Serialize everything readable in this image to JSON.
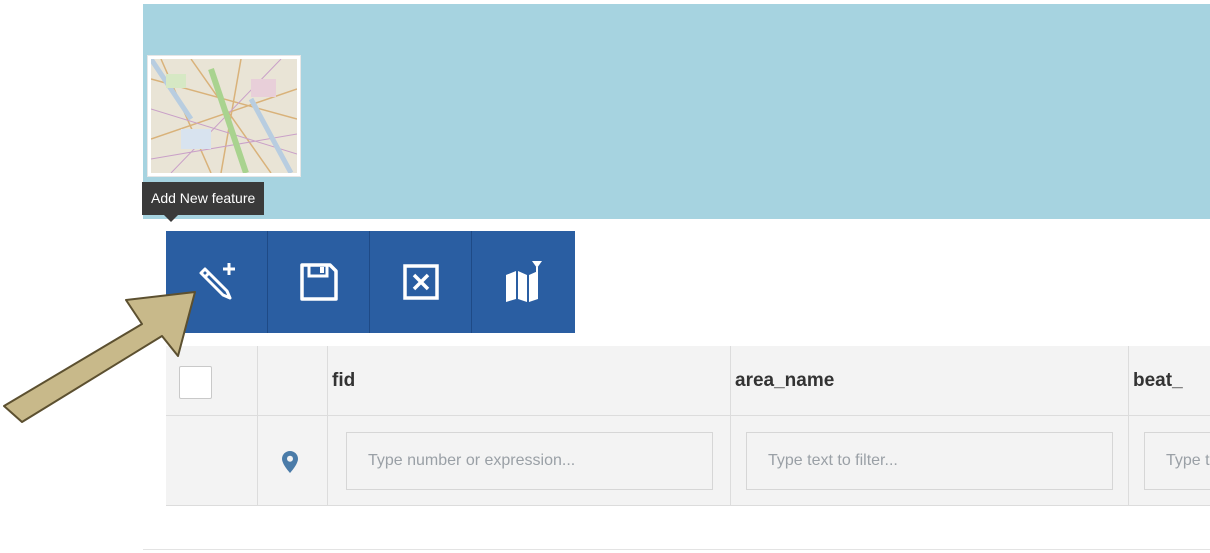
{
  "tooltip": {
    "text": "Add New feature"
  },
  "toolbar": {
    "buttons": [
      {
        "name": "add-feature",
        "icon": "pencil-plus-icon"
      },
      {
        "name": "save",
        "icon": "floppy-disk-icon"
      },
      {
        "name": "delete",
        "icon": "close-box-icon"
      },
      {
        "name": "filter-by-map",
        "icon": "map-filter-icon"
      }
    ]
  },
  "grid": {
    "columns": [
      "fid",
      "area_name",
      "beat_"
    ],
    "filters": {
      "fid_placeholder": "Type number or expression...",
      "area_name_placeholder": "Type text to filter...",
      "beat_placeholder": "Type text to filter..."
    }
  },
  "colors": {
    "map_background": "#a6d3e0",
    "toolbar": "#2a5ea2",
    "tooltip": "#3a3a3a",
    "pointer_arrow": "#c8b98a"
  }
}
